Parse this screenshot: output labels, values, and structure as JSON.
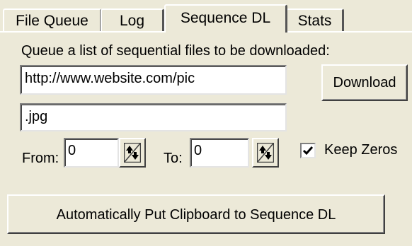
{
  "tabs": [
    {
      "label": "File Queue",
      "active": false
    },
    {
      "label": "Log",
      "active": false
    },
    {
      "label": "Sequence DL",
      "active": true
    },
    {
      "label": "Stats",
      "active": false
    }
  ],
  "sequence": {
    "instructions": "Queue a list of sequential files to be downloaded:",
    "url_value": "http://www.website.com/pic",
    "extension_value": ".jpg",
    "from_label": "From:",
    "from_value": "0",
    "to_label": "To:",
    "to_value": "0",
    "keep_zeros_label": "Keep Zeros",
    "keep_zeros_checked": true,
    "download_label": "Download",
    "auto_clipboard_label": "Automatically Put Clipboard to Sequence DL"
  },
  "icons": {
    "spinner": "up-down-arrows-icon",
    "checkmark": "checkmark-icon"
  },
  "colors": {
    "window_background": "#ece9d8",
    "field_background": "#ffffff",
    "shadow": "#404040",
    "highlight": "#ffffff"
  }
}
